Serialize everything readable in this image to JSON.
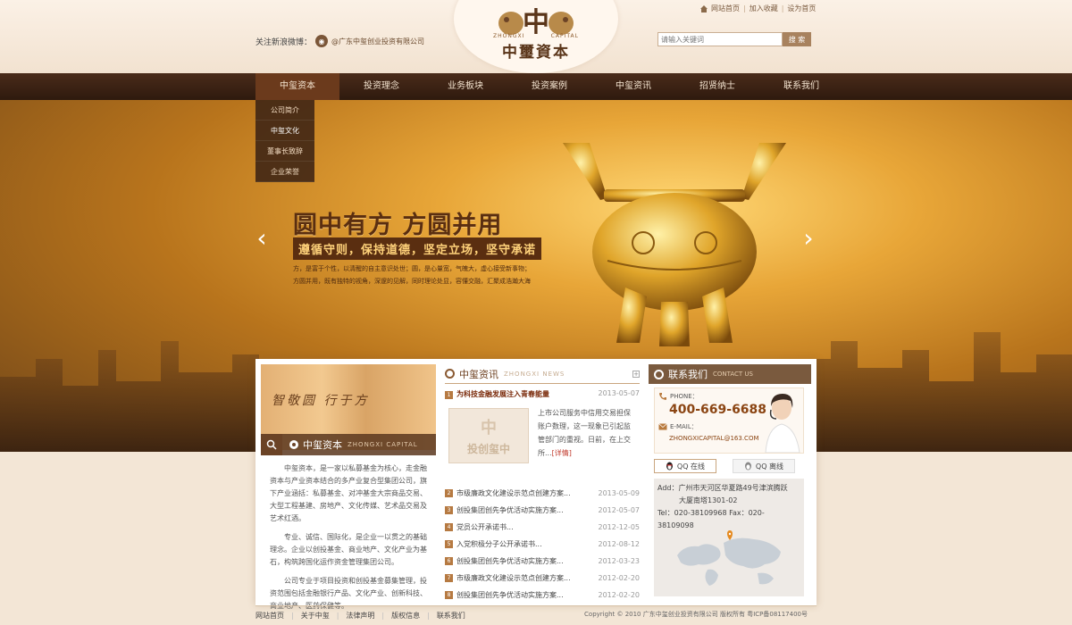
{
  "header": {
    "logo": {
      "badge": "中",
      "sub_left": "ZHONGXI",
      "sub_right": "CAPITAL",
      "name": "中璽資本"
    },
    "follow_label": "关注新浪微博：",
    "weibo_handle": "@广东中玺创业投资有限公司",
    "top_links": [
      "网站首页",
      "加入收藏",
      "设为首页"
    ],
    "search": {
      "placeholder": "请输入关键词",
      "button": "搜 索"
    }
  },
  "nav": {
    "items": [
      "中玺资本",
      "投资理念",
      "业务板块",
      "投资案例",
      "中玺资讯",
      "招贤纳士",
      "联系我们"
    ],
    "active": 0,
    "submenu": [
      "公司简介",
      "中玺文化",
      "董事长致辞",
      "企业荣誉"
    ]
  },
  "banner": {
    "title": "圆中有方 方圆并用",
    "subtitle": "遵循守则，保持道德，坚定立场，坚守承诺",
    "desc_line1": "方，是富于个性，以清醒的自主意识处世；圆，是心量宽，气魄大，虚心接受新事物；",
    "desc_line2": "方圆并用，既有独特的视角，深邃的见解，同时理论处显，容懂交融，汇聚成浩瀚大海"
  },
  "about": {
    "banner_text": "智敬圆 行于方",
    "title": "中玺资本",
    "title_en": "ZHONGXI CAPITAL",
    "p1": "中玺资本，是一家以私募基金为核心，走金融资本与产业资本结合的多产业复合型集团公司，旗下产业涵括：私募基金、对冲基金大宗商品交易、大型工程基建、房地产、文化传媒、艺术品交易及艺术红酒。",
    "p2": "专业、诚信、国际化，是企业一以贯之的基础理念。企业以创投基金、商业地产、文化产业为基石，构筑跨国化运作资金管理集团公司。",
    "p3": "公司专业于项目投资和创投基金募集管理，投资范围包括金融银行产品、文化产业、创新科技、商业地产、医药保健等。"
  },
  "news": {
    "title": "中玺资讯",
    "title_en": "ZHONGXI NEWS",
    "top": {
      "num": "1",
      "title": "为科技金融发展注入青春能量",
      "date": "2013-05-07"
    },
    "feature_img_text": "投创玺中",
    "feature_text": "上市公司服务中信用交易担保账户数理，这一现象已引起监管部门的重视。日前，在上交所...",
    "feature_detail": "[详情]",
    "list": [
      {
        "num": "2",
        "title": "市级廉政文化建设示范点创建方案...",
        "date": "2013-05-09"
      },
      {
        "num": "3",
        "title": "创投集团创先争优活动实施方案...",
        "date": "2012-05-07"
      },
      {
        "num": "4",
        "title": "党员公开承诺书...",
        "date": "2012-12-05"
      },
      {
        "num": "5",
        "title": "入党积极分子公开承诺书...",
        "date": "2012-08-12"
      },
      {
        "num": "6",
        "title": "创投集团创先争优活动实施方案...",
        "date": "2012-03-23"
      },
      {
        "num": "7",
        "title": "市级廉政文化建设示范点创建方案...",
        "date": "2012-02-20"
      },
      {
        "num": "8",
        "title": "创投集团创先争优活动实施方案...",
        "date": "2012-02-20"
      }
    ]
  },
  "contact": {
    "title": "联系我们",
    "title_en": "CONTACT US",
    "phone_label": "PHONE：",
    "phone": "400-669-6688",
    "email_label": "E-MAIL：",
    "email": "ZHONGXICAPITAL@163.COM",
    "qq_online": "QQ 在线",
    "qq_offline": "QQ 离线",
    "addr_line1": "Add：广州市天河区华夏路49号津滨腾跃",
    "addr_line2": "大厦南塔1301-02",
    "tel_fax": "Tel：020-38109968   Fax：020-38109098"
  },
  "footer": {
    "links": [
      "网站首页",
      "关于中玺",
      "法律声明",
      "版权信息",
      "联系我们"
    ],
    "copyright": "Copyright © 2010 广东中玺创业投资有限公司 版权所有 粤ICP备08117400号"
  },
  "colors": {
    "brand": "#5a3519",
    "nav_bg": "#2e1a0e",
    "accent": "#8b4513",
    "detail": "#c0392b"
  }
}
